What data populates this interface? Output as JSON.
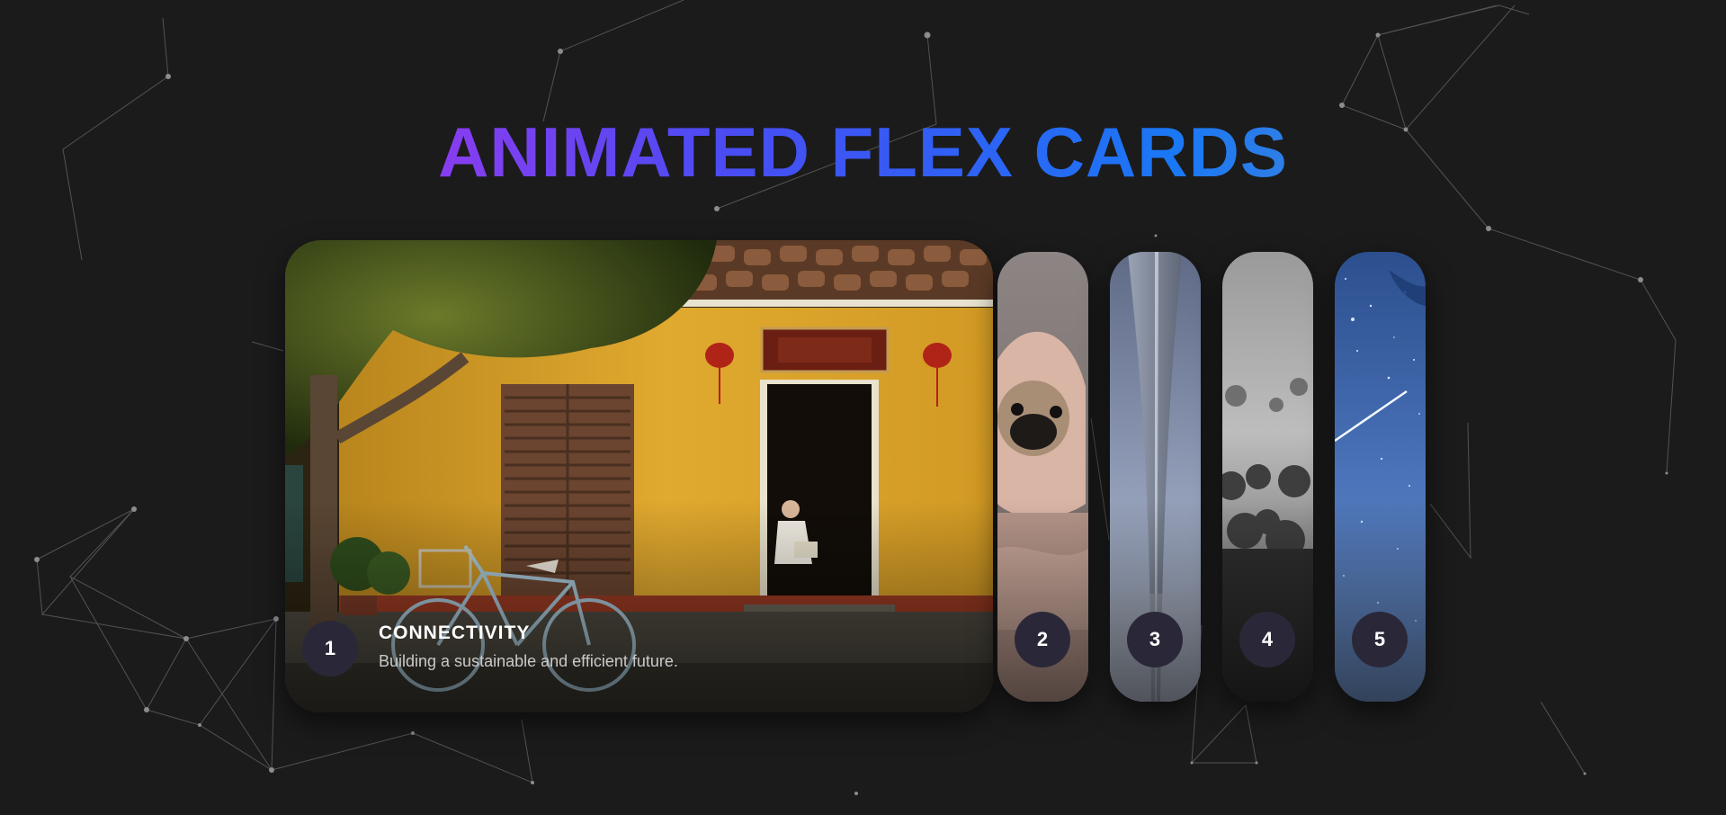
{
  "page": {
    "title": "ANIMATED FLEX CARDS"
  },
  "cards": [
    {
      "number": "1",
      "title": "CONNECTIVITY",
      "subtitle": "Building a sustainable and efficient future.",
      "image": "yellow-house-bicycle-photo",
      "active": true
    },
    {
      "number": "2",
      "image": "pug-in-blanket-photo",
      "active": false
    },
    {
      "number": "3",
      "image": "tall-tower-sky-photo",
      "active": false
    },
    {
      "number": "4",
      "image": "misty-forest-photo",
      "active": false
    },
    {
      "number": "5",
      "image": "starry-sky-meteor-photo",
      "active": false
    }
  ],
  "colors": {
    "background": "#1b1b1c",
    "title_gradient": [
      "#b52cb9",
      "#8a3cf0",
      "#4a4cf2",
      "#1a78f5",
      "#7891a8"
    ],
    "number_badge": "#2a2838",
    "network_lines": "#6e6e70"
  }
}
